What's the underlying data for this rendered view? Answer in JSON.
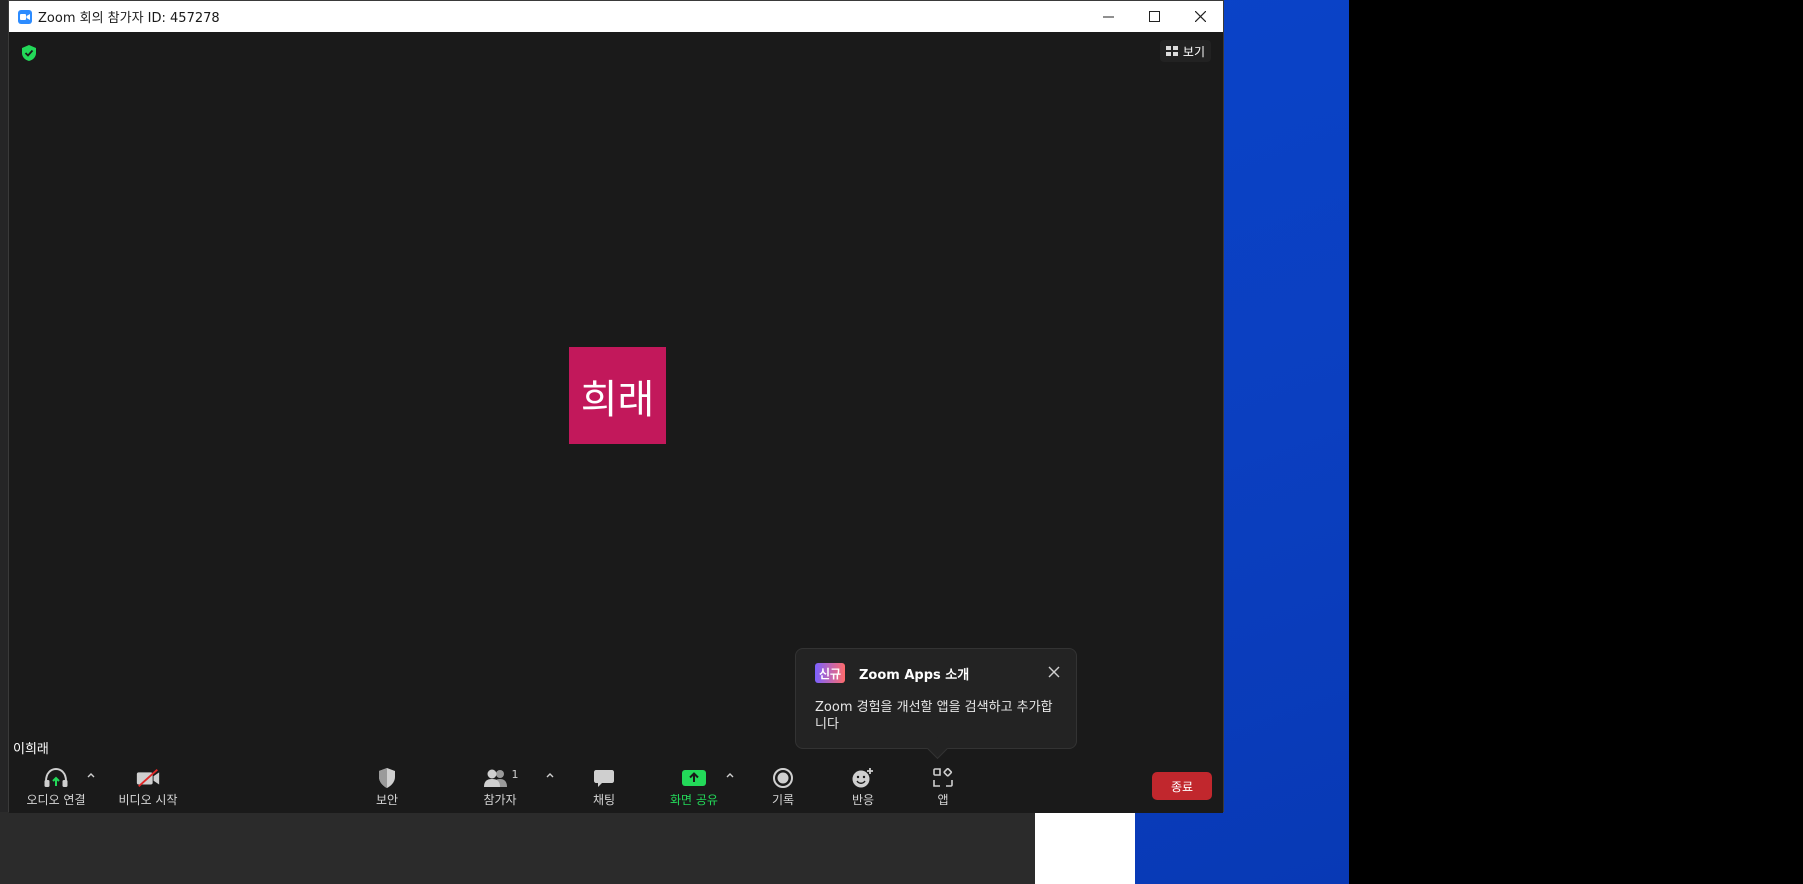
{
  "window": {
    "title": "Zoom 회의 참가자 ID: 457278"
  },
  "stage": {
    "view_label": "보기",
    "avatar_initials": "희래",
    "avatar_color": "#c2185b",
    "participant_name": "이희래"
  },
  "popup": {
    "badge": "신규",
    "title": "Zoom Apps 소개",
    "body": "Zoom 경험을 개선할 앱을 검색하고 추가합니다"
  },
  "toolbar": {
    "audio_label": "오디오 연결",
    "video_label": "비디오 시작",
    "security_label": "보안",
    "participants_label": "참가자",
    "participants_count": "1",
    "chat_label": "채팅",
    "share_label": "화면 공유",
    "record_label": "기록",
    "reactions_label": "반응",
    "apps_label": "앱",
    "end_label": "종료"
  },
  "colors": {
    "accent_green": "#23d959",
    "end_red": "#c1272d",
    "zoom_blue": "#2d8cff"
  }
}
